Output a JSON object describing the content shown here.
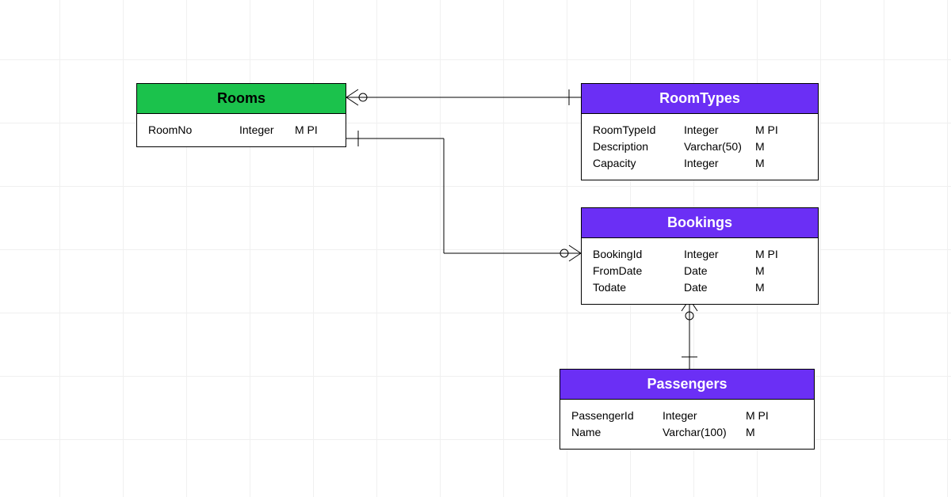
{
  "entities": {
    "rooms": {
      "title": "Rooms",
      "attrs": [
        {
          "name": "RoomNo",
          "type": "Integer",
          "flags": "M PI"
        }
      ]
    },
    "roomtypes": {
      "title": "RoomTypes",
      "attrs": [
        {
          "name": "RoomTypeId",
          "type": "Integer",
          "flags": "M PI"
        },
        {
          "name": "Description",
          "type": "Varchar(50)",
          "flags": "M"
        },
        {
          "name": "Capacity",
          "type": "Integer",
          "flags": "M"
        }
      ]
    },
    "bookings": {
      "title": "Bookings",
      "attrs": [
        {
          "name": "BookingId",
          "type": "Integer",
          "flags": "M PI"
        },
        {
          "name": "FromDate",
          "type": "Date",
          "flags": "M"
        },
        {
          "name": "Todate",
          "type": "Date",
          "flags": "M"
        }
      ]
    },
    "passengers": {
      "title": "Passengers",
      "attrs": [
        {
          "name": "PassengerId",
          "type": "Integer",
          "flags": "M PI"
        },
        {
          "name": "Name",
          "type": "Varchar(100)",
          "flags": "M"
        }
      ]
    }
  },
  "relationships": [
    {
      "from": "Rooms",
      "to": "RoomTypes",
      "fromCard": "many-optional",
      "toCard": "one-mandatory"
    },
    {
      "from": "Rooms",
      "to": "Bookings",
      "fromCard": "one-mandatory",
      "toCard": "many-optional"
    },
    {
      "from": "Bookings",
      "to": "Passengers",
      "fromCard": "many-optional",
      "toCard": "one-mandatory"
    }
  ]
}
